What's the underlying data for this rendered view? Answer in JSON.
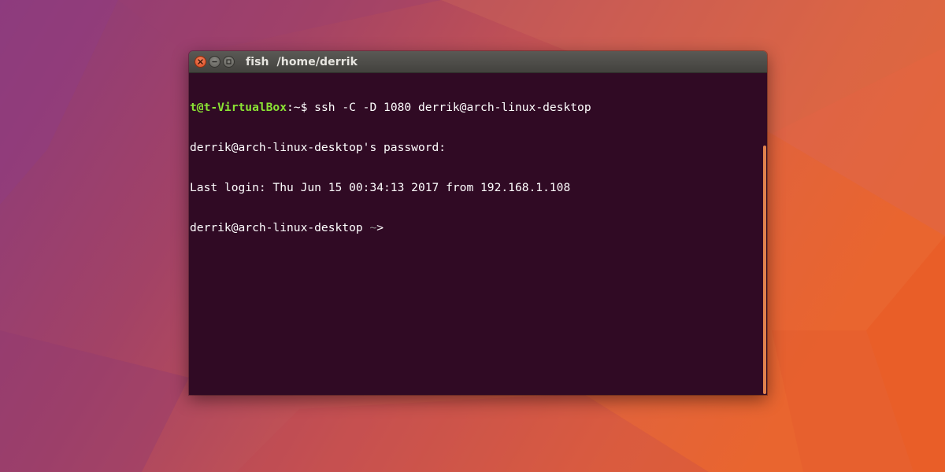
{
  "window": {
    "title_app": "fish",
    "title_path": "/home/derrik"
  },
  "terminal": {
    "line1": {
      "prompt_user": "t@t-VirtualBox",
      "prompt_sep": ":~$ ",
      "command": "ssh -C -D 1080 derrik@arch-linux-desktop"
    },
    "line2": "derrik@arch-linux-desktop's password:",
    "line3": "Last login: Thu Jun 15 00:34:13 2017 from 192.168.1.108",
    "line4": {
      "host": "derrik@arch-linux-desktop ",
      "tilde": "~",
      "arrow": ">"
    }
  },
  "colors": {
    "terminal_bg": "#300a24",
    "prompt_green": "#8ae234",
    "scrollbar_accent": "#e0824e",
    "close_button": "#dc4a20"
  },
  "icons": {
    "close": "close-icon",
    "minimize": "minimize-icon",
    "maximize": "maximize-icon"
  }
}
